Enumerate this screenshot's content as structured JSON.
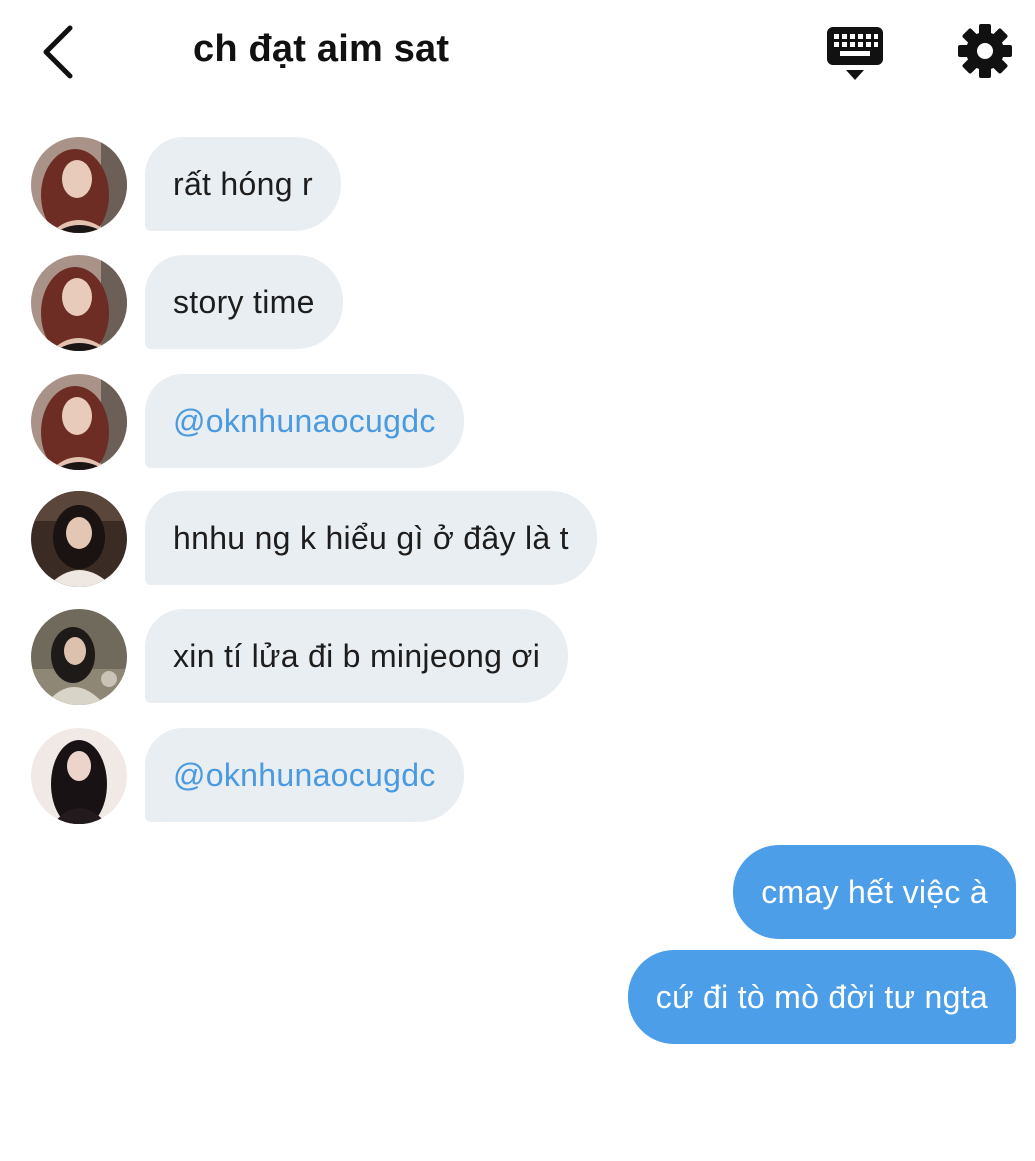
{
  "header": {
    "title": "ch đạt aim sat",
    "back_icon": "chevron-left-icon",
    "keyboard_icon": "keyboard-icon",
    "settings_icon": "gear-icon"
  },
  "messages_incoming": [
    {
      "text": "rất hóng r",
      "avatar": "avatar-red-hair",
      "mention": false
    },
    {
      "text": "story time",
      "avatar": "avatar-red-hair",
      "mention": false
    },
    {
      "text": "@oknhunaocugdc",
      "avatar": "avatar-red-hair",
      "mention": true
    },
    {
      "text": "hnhu ng k hiểu gì ở đây là t",
      "avatar": "avatar-white-top",
      "mention": false
    },
    {
      "text": "xin tí lửa đi b minjeong ơi",
      "avatar": "avatar-cafe",
      "mention": false
    },
    {
      "text": "@oknhunaocugdc",
      "avatar": "avatar-dark-hair",
      "mention": true
    }
  ],
  "messages_outgoing": [
    {
      "text": "cmay hết việc à"
    },
    {
      "text": "cứ đi tò mò đời tư ngta"
    }
  ],
  "colors": {
    "incoming_bubble": "#e9eef3",
    "outgoing_bubble": "#4d9ee8",
    "mention_text": "#4a9ae0",
    "text_dark": "#1d1d1d"
  }
}
